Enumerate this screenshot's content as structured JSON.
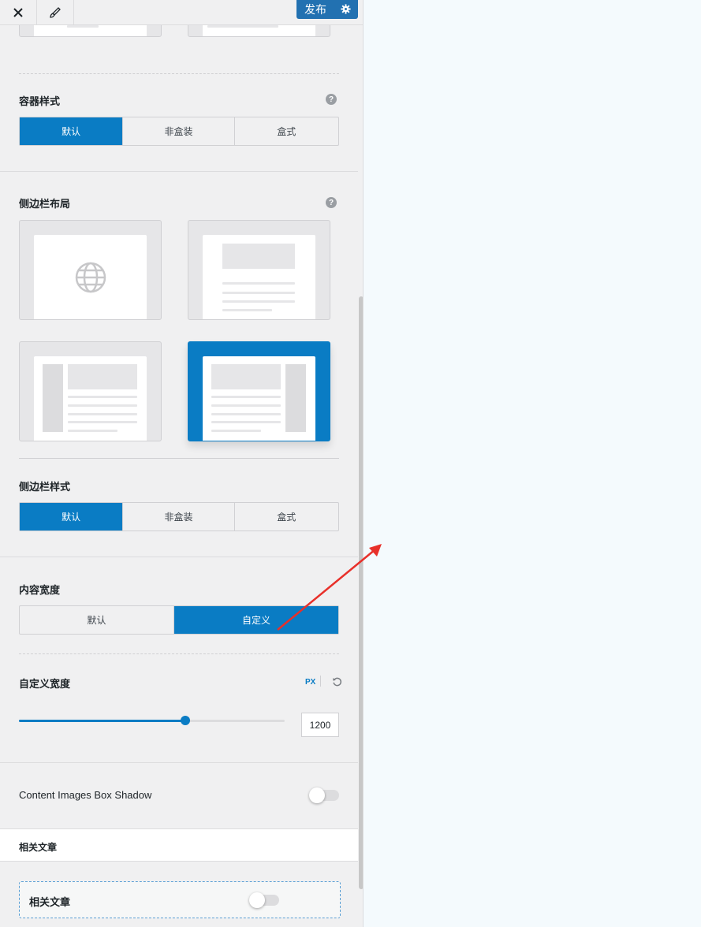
{
  "topbar": {
    "publish_label": "发布"
  },
  "container_style": {
    "label": "容器样式",
    "options": [
      "默认",
      "非盒装",
      "盒式"
    ],
    "selected": "默认"
  },
  "sidebar_layout": {
    "label": "侧边栏布局",
    "selected": "right-sidebar"
  },
  "sidebar_style": {
    "label": "侧边栏样式",
    "options": [
      "默认",
      "非盒装",
      "盒式"
    ],
    "selected": "默认"
  },
  "content_width": {
    "label": "内容宽度",
    "options": [
      "默认",
      "自定义"
    ],
    "selected": "自定义"
  },
  "custom_width": {
    "label": "自定义宽度",
    "unit": "PX",
    "value": "1200",
    "slider_fraction": 0.625
  },
  "box_shadow": {
    "label": "Content Images Box Shadow",
    "enabled": false
  },
  "related_posts_section": {
    "title": "相关文章"
  },
  "related_posts_toggle": {
    "label": "相关文章",
    "enabled": false
  },
  "colors": {
    "accent": "#0a7cc4",
    "annotation_arrow": "#e8302a"
  }
}
